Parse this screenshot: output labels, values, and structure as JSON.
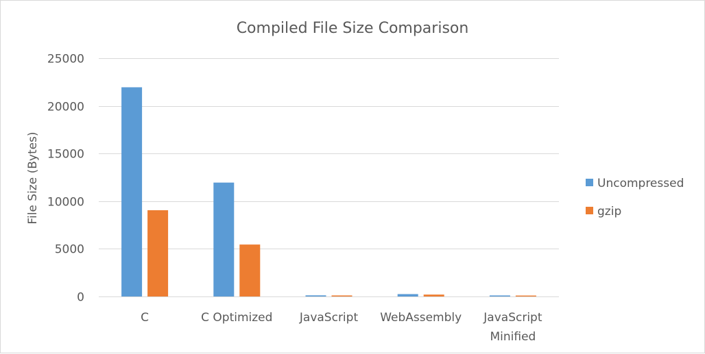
{
  "chart_data": {
    "type": "bar",
    "title": "Compiled File Size Comparison",
    "ylabel": "File Size (Bytes)",
    "xlabel": "",
    "ylim": [
      0,
      25000
    ],
    "yticks": [
      0,
      5000,
      10000,
      15000,
      20000,
      25000
    ],
    "grid": true,
    "legend_position": "right",
    "categories": [
      [
        "C"
      ],
      [
        "C Optimized"
      ],
      [
        "JavaScript"
      ],
      [
        "WebAssembly"
      ],
      [
        "JavaScript",
        "Minified"
      ]
    ],
    "series": [
      {
        "name": "Uncompressed",
        "color": "#5b9bd5",
        "values": [
          21950,
          11950,
          120,
          250,
          110
        ]
      },
      {
        "name": "gzip",
        "color": "#ed7d31",
        "values": [
          9050,
          5450,
          110,
          200,
          100
        ]
      }
    ]
  }
}
